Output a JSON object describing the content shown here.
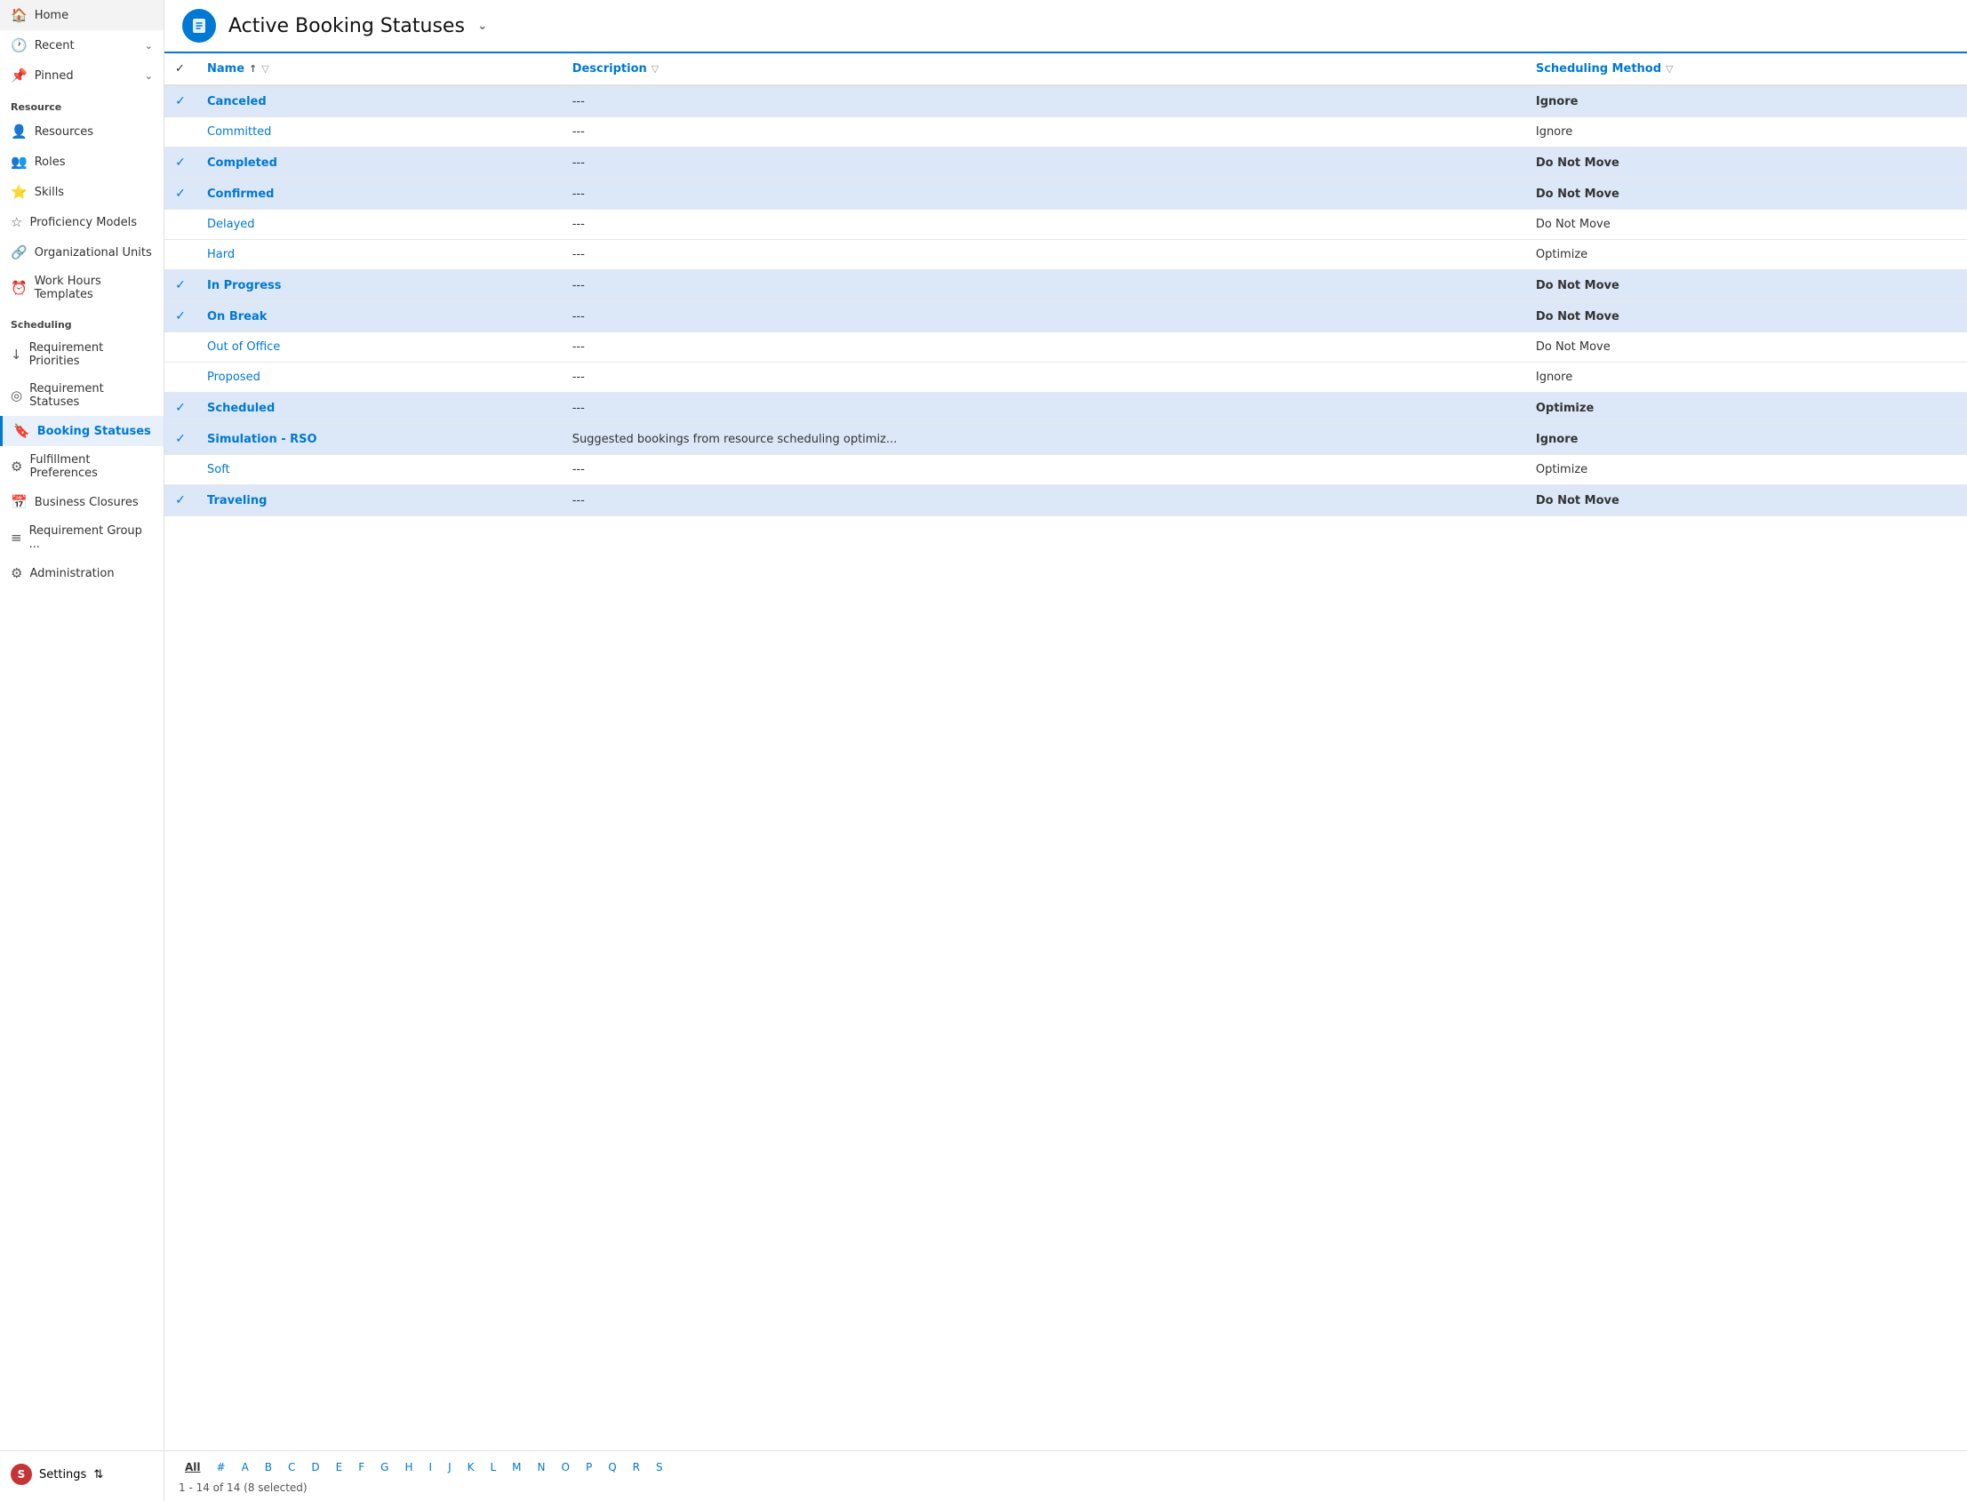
{
  "sidebar": {
    "nav_top": [
      {
        "id": "home",
        "label": "Home",
        "icon": "🏠"
      },
      {
        "id": "recent",
        "label": "Recent",
        "icon": "🕐",
        "hasChevron": true
      },
      {
        "id": "pinned",
        "label": "Pinned",
        "icon": "📌",
        "hasChevron": true
      }
    ],
    "section_resource": "Resource",
    "resource_items": [
      {
        "id": "resources",
        "label": "Resources",
        "icon": "👤"
      },
      {
        "id": "roles",
        "label": "Roles",
        "icon": "👥"
      },
      {
        "id": "skills",
        "label": "Skills",
        "icon": "⭐"
      },
      {
        "id": "proficiency-models",
        "label": "Proficiency Models",
        "icon": "☆"
      },
      {
        "id": "organizational-units",
        "label": "Organizational Units",
        "icon": "🔗"
      },
      {
        "id": "work-hours-templates",
        "label": "Work Hours Templates",
        "icon": "⏰"
      }
    ],
    "section_scheduling": "Scheduling",
    "scheduling_items": [
      {
        "id": "requirement-priorities",
        "label": "Requirement Priorities",
        "icon": "↓"
      },
      {
        "id": "requirement-statuses",
        "label": "Requirement Statuses",
        "icon": "◎"
      },
      {
        "id": "booking-statuses",
        "label": "Booking Statuses",
        "icon": "🔖",
        "active": true
      },
      {
        "id": "fulfillment-preferences",
        "label": "Fulfillment Preferences",
        "icon": "⚙"
      },
      {
        "id": "business-closures",
        "label": "Business Closures",
        "icon": "📅"
      },
      {
        "id": "requirement-group",
        "label": "Requirement Group ...",
        "icon": "≡"
      },
      {
        "id": "administration",
        "label": "Administration",
        "icon": "⚙"
      }
    ],
    "settings": {
      "label": "Settings",
      "avatar_letter": "S"
    }
  },
  "header": {
    "title": "Active Booking Statuses",
    "icon": "🔖"
  },
  "table": {
    "columns": [
      {
        "id": "checkbox",
        "label": ""
      },
      {
        "id": "name",
        "label": "Name",
        "sortable": true,
        "filterable": true
      },
      {
        "id": "description",
        "label": "Description",
        "filterable": true
      },
      {
        "id": "scheduling-method",
        "label": "Scheduling Method",
        "filterable": true
      }
    ],
    "rows": [
      {
        "id": 1,
        "selected": true,
        "name": "Canceled",
        "description": "---",
        "schedulingMethod": "Ignore"
      },
      {
        "id": 2,
        "selected": false,
        "name": "Committed",
        "description": "---",
        "schedulingMethod": "Ignore"
      },
      {
        "id": 3,
        "selected": true,
        "name": "Completed",
        "description": "---",
        "schedulingMethod": "Do Not Move"
      },
      {
        "id": 4,
        "selected": true,
        "name": "Confirmed",
        "description": "---",
        "schedulingMethod": "Do Not Move"
      },
      {
        "id": 5,
        "selected": false,
        "name": "Delayed",
        "description": "---",
        "schedulingMethod": "Do Not Move"
      },
      {
        "id": 6,
        "selected": false,
        "name": "Hard",
        "description": "---",
        "schedulingMethod": "Optimize"
      },
      {
        "id": 7,
        "selected": true,
        "name": "In Progress",
        "description": "---",
        "schedulingMethod": "Do Not Move"
      },
      {
        "id": 8,
        "selected": true,
        "name": "On Break",
        "description": "---",
        "schedulingMethod": "Do Not Move"
      },
      {
        "id": 9,
        "selected": false,
        "name": "Out of Office",
        "description": "---",
        "schedulingMethod": "Do Not Move"
      },
      {
        "id": 10,
        "selected": false,
        "name": "Proposed",
        "description": "---",
        "schedulingMethod": "Ignore"
      },
      {
        "id": 11,
        "selected": true,
        "name": "Scheduled",
        "description": "---",
        "schedulingMethod": "Optimize"
      },
      {
        "id": 12,
        "selected": true,
        "name": "Simulation - RSO",
        "description": "Suggested bookings from resource scheduling optimiz...",
        "schedulingMethod": "Ignore"
      },
      {
        "id": 13,
        "selected": false,
        "name": "Soft",
        "description": "---",
        "schedulingMethod": "Optimize"
      },
      {
        "id": 14,
        "selected": true,
        "name": "Traveling",
        "description": "---",
        "schedulingMethod": "Do Not Move"
      }
    ]
  },
  "pagination": {
    "letters": [
      "All",
      "#",
      "A",
      "B",
      "C",
      "D",
      "E",
      "F",
      "G",
      "H",
      "I",
      "J",
      "K",
      "L",
      "M",
      "N",
      "O",
      "P",
      "Q",
      "R",
      "S"
    ],
    "active_letter": "All",
    "summary": "1 - 14 of 14 (8 selected)"
  },
  "colors": {
    "accent": "#0078d4",
    "selected_row_bg": "#dce8f8",
    "header_border": "#0078d4"
  }
}
